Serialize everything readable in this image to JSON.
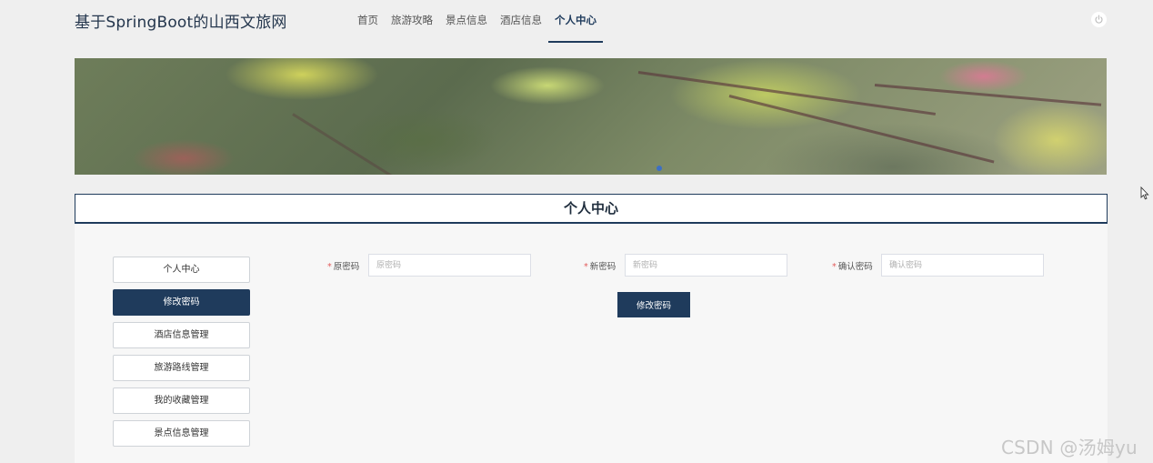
{
  "header": {
    "site_title": "基于SpringBoot的山西文旅网",
    "nav": [
      {
        "label": "首页",
        "active": false
      },
      {
        "label": "旅游攻略",
        "active": false
      },
      {
        "label": "景点信息",
        "active": false
      },
      {
        "label": "酒店信息",
        "active": false
      },
      {
        "label": "个人中心",
        "active": true
      }
    ],
    "power_icon": "power-icon"
  },
  "section": {
    "title": "个人中心"
  },
  "side_menu": [
    {
      "label": "个人中心",
      "active": false
    },
    {
      "label": "修改密码",
      "active": true
    },
    {
      "label": "酒店信息管理",
      "active": false
    },
    {
      "label": "旅游路线管理",
      "active": false
    },
    {
      "label": "我的收藏管理",
      "active": false
    },
    {
      "label": "景点信息管理",
      "active": false
    }
  ],
  "form": {
    "required_mark": "*",
    "old_password": {
      "label": "原密码",
      "placeholder": "原密码",
      "value": ""
    },
    "new_password": {
      "label": "新密码",
      "placeholder": "新密码",
      "value": ""
    },
    "confirm_password": {
      "label": "确认密码",
      "placeholder": "确认密码",
      "value": ""
    },
    "submit_label": "修改密码"
  },
  "watermark": "CSDN @汤姆yu",
  "colors": {
    "accent": "#1f3b5c",
    "required": "#e25c5c",
    "page_bg": "#efefef"
  }
}
